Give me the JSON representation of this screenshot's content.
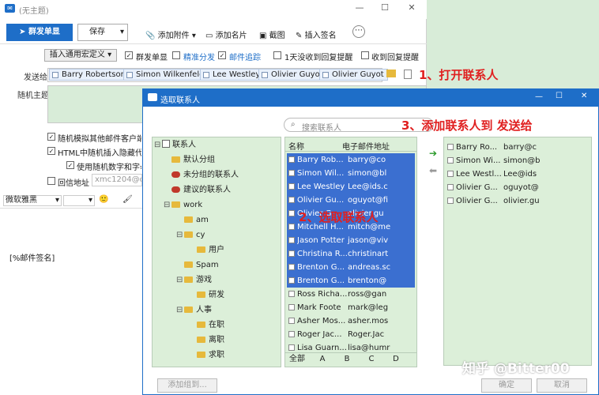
{
  "window": {
    "title": "(无主题)",
    "minimize": "—",
    "maximize": "☐",
    "close": "✕"
  },
  "toolbar": {
    "send_label": "群发单显",
    "save_label": "保存",
    "attach_label": "添加附件",
    "card_label": "添加名片",
    "screenshot_label": "截图",
    "signature_label": "插入签名",
    "more": "⋯"
  },
  "options": {
    "macro": "插入通用宏定义",
    "group_send": "群发单显",
    "precise": "精准分发",
    "track": "邮件追踪",
    "no_reply": "1天没收到回复提醒",
    "reply_notice": "收到回复提醒"
  },
  "fields": {
    "to_label": "发送给",
    "subject_label": "随机主题",
    "reply_label": "回信地址",
    "reply_value": "xmc1204@qq"
  },
  "recipients": [
    "Barry Robertson",
    "Simon Wilkenfeld",
    "Lee Westley",
    "Olivier Guyot",
    "Olivier Guyot"
  ],
  "more_opts": {
    "mimic": "随机模拟其他邮件客户端发",
    "html_hidden": "HTML中随机插入隐藏代码",
    "use_random": "使用随机数字和字母"
  },
  "format": {
    "font": "微软雅黑",
    "emoji": "🙂",
    "brush": "🖌"
  },
  "editor": {
    "placeholder": "[%邮件签名]"
  },
  "annotations": {
    "step1": "1、打开联系人",
    "step2": "2、选取联系人",
    "step3": "3、添加联系人到 发送给"
  },
  "dialog": {
    "title": "选取联系人",
    "search_placeholder": "搜索联系人",
    "tree": [
      {
        "label": "联系人",
        "type": "root"
      },
      {
        "label": "默认分组",
        "type": "folder"
      },
      {
        "label": "未分组的联系人",
        "type": "group"
      },
      {
        "label": "建议的联系人",
        "type": "group"
      },
      {
        "label": "work",
        "type": "folder"
      },
      {
        "label": "am",
        "type": "folder"
      },
      {
        "label": "cy",
        "type": "folder"
      },
      {
        "label": "用户",
        "type": "folder"
      },
      {
        "label": "Spam",
        "type": "folder"
      },
      {
        "label": "游戏",
        "type": "folder"
      },
      {
        "label": "研发",
        "type": "folder"
      },
      {
        "label": "人事",
        "type": "folder"
      },
      {
        "label": "在职",
        "type": "folder"
      },
      {
        "label": "离职",
        "type": "folder"
      },
      {
        "label": "求职",
        "type": "folder"
      }
    ],
    "columns": {
      "name": "名称",
      "email": "电子邮件地址"
    },
    "contacts": [
      {
        "name": "Barry Rob...",
        "email": "barry@co",
        "selected": true
      },
      {
        "name": "Simon Wil...",
        "email": "simon@bl",
        "selected": true
      },
      {
        "name": "Lee Westley",
        "email": "Lee@ids.c",
        "selected": true
      },
      {
        "name": "Olivier Gu...",
        "email": "oguyot@fi",
        "selected": true
      },
      {
        "name": "Olivier G...",
        "email": "olivier.gu",
        "selected": true
      },
      {
        "name": "Mitchell H...",
        "email": "mitch@me",
        "selected": true
      },
      {
        "name": "Jason Potter",
        "email": "jason@viv",
        "selected": true
      },
      {
        "name": "Christina R...",
        "email": "christinart",
        "selected": true
      },
      {
        "name": "Brenton G...",
        "email": "andreas.sc",
        "selected": true
      },
      {
        "name": "Brenton G...",
        "email": "brenton@",
        "selected": true
      },
      {
        "name": "Ross Richa...",
        "email": "ross@gan",
        "selected": false
      },
      {
        "name": "Mark Foote",
        "email": "mark@leg",
        "selected": false
      },
      {
        "name": "Asher Mos...",
        "email": "asher.mos",
        "selected": false
      },
      {
        "name": "Roger Jac...",
        "email": "Roger.Jac",
        "selected": false
      },
      {
        "name": "Lisa Guarn...",
        "email": "lisa@humr",
        "selected": false
      }
    ],
    "alpha": [
      "全部",
      "A",
      "B",
      "C",
      "D"
    ],
    "added": [
      {
        "name": "Barry Ro...",
        "email": "barry@c"
      },
      {
        "name": "Simon Wi...",
        "email": "simon@b"
      },
      {
        "name": "Lee Westl...",
        "email": "Lee@ids"
      },
      {
        "name": "Olivier G...",
        "email": "oguyot@"
      },
      {
        "name": "Olivier G...",
        "email": "olivier.gu"
      }
    ],
    "add_group": "添加组到...",
    "ok": "确定",
    "cancel": "取消",
    "add_arrow": "➔",
    "remove_arrow": "⬅"
  },
  "watermark": "知乎 @Bitter00"
}
